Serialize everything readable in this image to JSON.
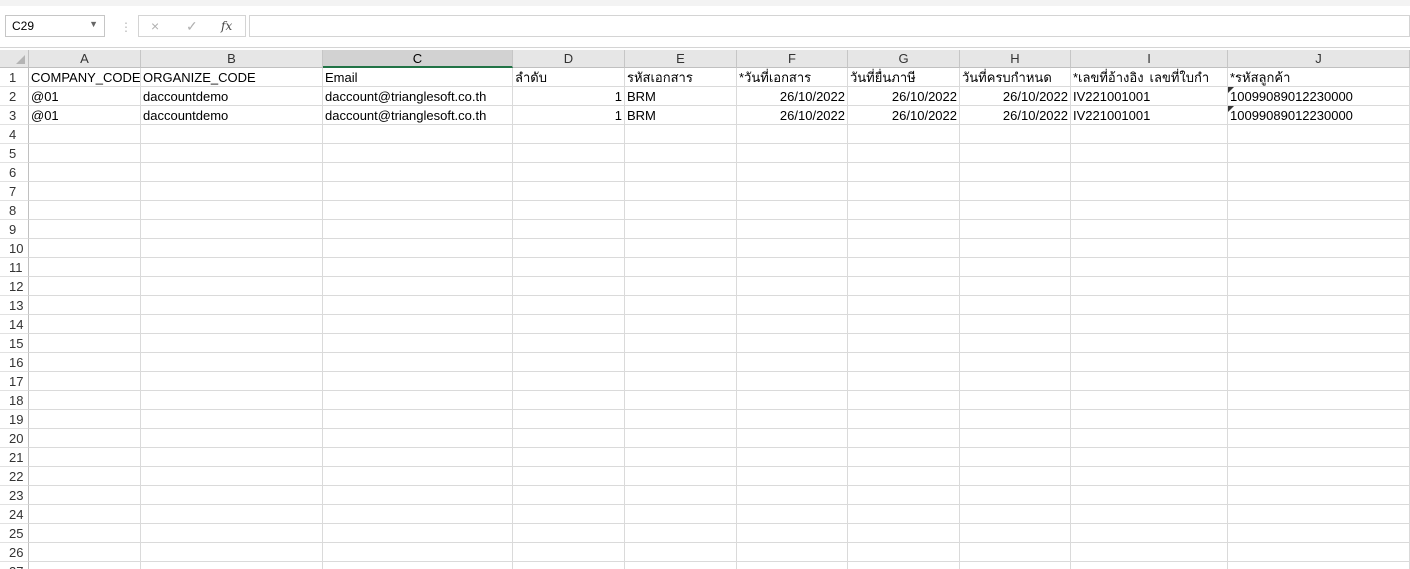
{
  "name_box": {
    "value": "C29"
  },
  "formula_bar": {
    "cancel_icon": "×",
    "enter_icon": "✓",
    "fx_icon": "fx",
    "value": ""
  },
  "columns": [
    "A",
    "B",
    "C",
    "D",
    "E",
    "F",
    "G",
    "H",
    "I",
    "J"
  ],
  "selected_column": "C",
  "row_numbers": [
    "1",
    "2",
    "3",
    "4",
    "5",
    "6",
    "7",
    "8",
    "9",
    "10",
    "11",
    "12",
    "13",
    "14",
    "15",
    "16",
    "17",
    "18",
    "19",
    "20",
    "21",
    "22",
    "23",
    "24",
    "25",
    "26",
    "27"
  ],
  "rows": [
    [
      "COMPANY_CODE",
      "ORGANIZE_CODE",
      "Email",
      "ลำดับ",
      "รหัสเอกสาร",
      "*วันที่เอกสาร",
      "วันที่ยื่นภาษี",
      "วันที่ครบกำหนด",
      "*เลขที่อ้างอิง",
      "เลขที่ใบกำ",
      "*รหัสลูกค้า"
    ],
    [
      "@01",
      "daccountdemo",
      "daccount@trianglesoft.co.th",
      "1",
      "BRM",
      "26/10/2022",
      "26/10/2022",
      "26/10/2022",
      "IV221001001",
      "",
      "10099089012230000"
    ],
    [
      "@01",
      "daccountdemo",
      "daccount@trianglesoft.co.th",
      "1",
      "BRM",
      "26/10/2022",
      "26/10/2022",
      "26/10/2022",
      "IV221001001",
      "",
      "10099089012230000"
    ]
  ]
}
